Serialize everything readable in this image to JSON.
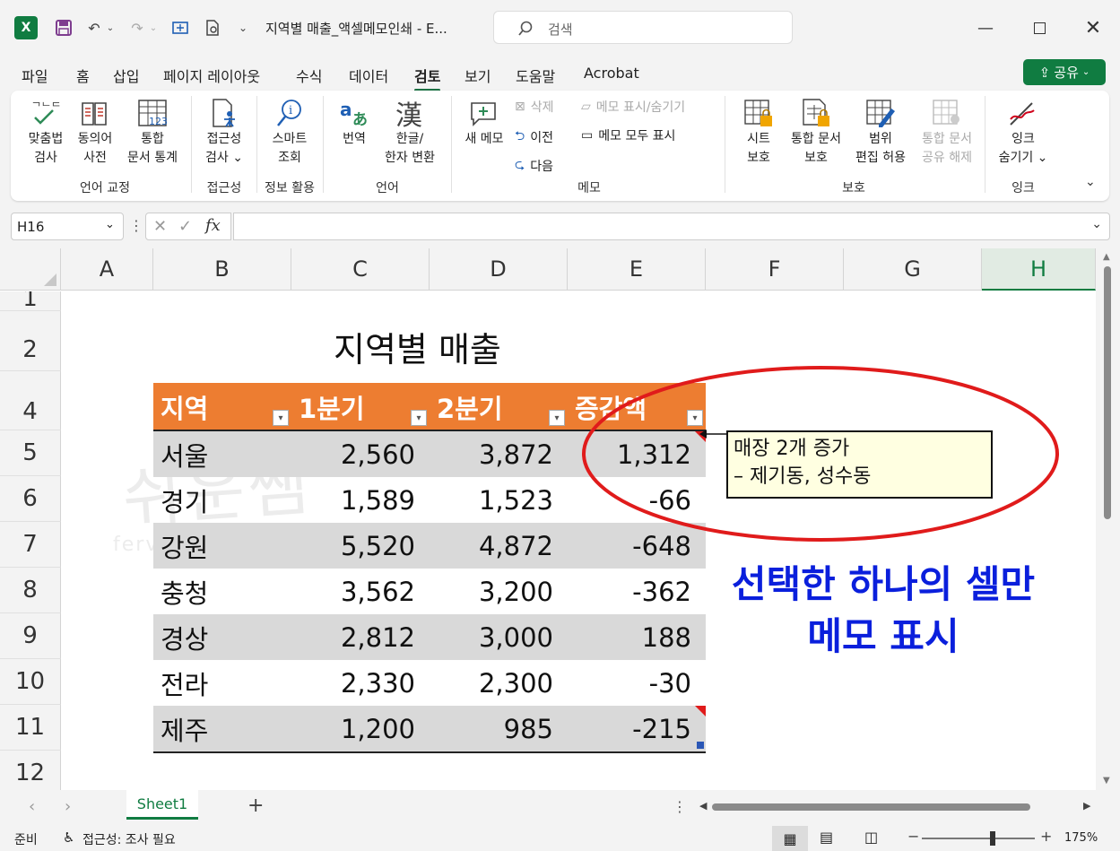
{
  "window": {
    "doc_title": "지역별 매출_액셀메모인쇄  -  E...",
    "search_placeholder": "검색"
  },
  "tabs": [
    "파일",
    "홈",
    "삽입",
    "페이지 레이아웃",
    "수식",
    "데이터",
    "검토",
    "보기",
    "도움말",
    "Acrobat"
  ],
  "active_tab": "검토",
  "share_label": "공유",
  "ribbon": {
    "proofing": {
      "spell": [
        "맞춤법",
        "검사"
      ],
      "thesaurus": [
        "동의어",
        "사전"
      ],
      "stats": [
        "통합",
        "문서 통계"
      ],
      "group": "언어 교정"
    },
    "access": {
      "check": [
        "접근성",
        "검사 ⌄"
      ],
      "group": "접근성"
    },
    "insights": {
      "smart": [
        "스마트",
        "조회"
      ],
      "group": "정보 활용"
    },
    "language": {
      "translate": "번역",
      "hanja": [
        "한글/",
        "한자 변환"
      ],
      "group": "언어"
    },
    "comments": {
      "new": [
        "새 메모"
      ],
      "delete": "삭제",
      "prev": "이전",
      "next": "다음",
      "show_hide": "메모 표시/숨기기",
      "show_all": "메모 모두 표시",
      "group": "메모"
    },
    "protect": {
      "sheet": [
        "시트",
        "보호"
      ],
      "workbook": [
        "통합 문서",
        "보호"
      ],
      "ranges": [
        "범위",
        "편집 허용"
      ],
      "unshare": [
        "통합 문서",
        "공유 해제"
      ],
      "group": "보호"
    },
    "ink": {
      "hide": [
        "잉크",
        "숨기기 ⌄"
      ],
      "group": "잉크"
    }
  },
  "formula_bar": {
    "name_box": "H16",
    "fx": "fx",
    "value": ""
  },
  "columns": [
    "A",
    "B",
    "C",
    "D",
    "E",
    "F",
    "G",
    "H"
  ],
  "selected_column": "H",
  "rows": [
    "1",
    "2",
    "4",
    "5",
    "6",
    "7",
    "8",
    "9",
    "10",
    "11",
    "12"
  ],
  "sheet_title": "지역별 매출",
  "table": {
    "headers": [
      "지역",
      "1분기",
      "2분기",
      "증감액"
    ],
    "rows": [
      [
        "서울",
        "2,560",
        "3,872",
        "1,312"
      ],
      [
        "경기",
        "1,589",
        "1,523",
        "-66"
      ],
      [
        "강원",
        "5,520",
        "4,872",
        "-648"
      ],
      [
        "충청",
        "3,562",
        "3,200",
        "-362"
      ],
      [
        "경상",
        "2,812",
        "3,000",
        "188"
      ],
      [
        "전라",
        "2,330",
        "2,300",
        "-30"
      ],
      [
        "제주",
        "1,200",
        "985",
        "-215"
      ]
    ]
  },
  "note": {
    "line1": "매장 2개 증가",
    "line2": "– 제기동, 성수동"
  },
  "callout": {
    "line1": "선택한 하나의 셀만",
    "line2": "메모 표시"
  },
  "watermark": {
    "main": "쉬운쌤",
    "sub": "fervent.tistory.com"
  },
  "sheet_tabs": {
    "name": "Sheet1",
    "add": "+"
  },
  "status": {
    "ready": "준비",
    "accessibility": "접근성: 조사 필요",
    "zoom": "175%"
  },
  "colors": {
    "accent": "#107c41",
    "header": "#ed7d31",
    "band": "#d9d9d9",
    "callout": "#0a1fdc",
    "ellipse": "#e01b1b"
  }
}
